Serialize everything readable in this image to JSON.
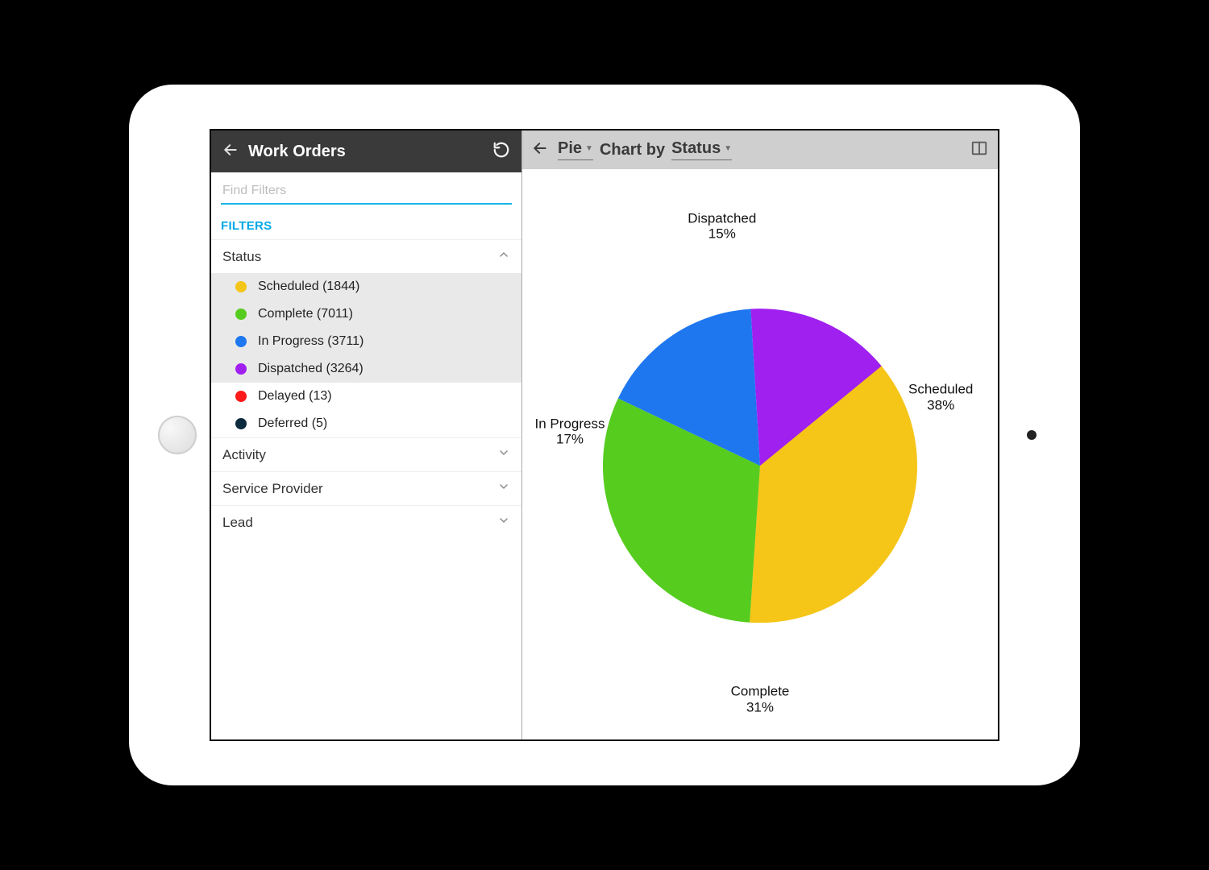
{
  "left": {
    "title": "Work Orders",
    "search_placeholder": "Find Filters",
    "filters_label": "FILTERS",
    "sections": {
      "status": {
        "label": "Status",
        "expanded": true
      },
      "activity": {
        "label": "Activity",
        "expanded": false
      },
      "service_provider": {
        "label": "Service Provider",
        "expanded": false
      },
      "lead": {
        "label": "Lead",
        "expanded": false
      }
    },
    "status_items": [
      {
        "label": "Scheduled (1844)",
        "color": "#f5c518",
        "selected": true
      },
      {
        "label": "Complete (7011)",
        "color": "#56cc1f",
        "selected": true
      },
      {
        "label": "In Progress (3711)",
        "color": "#1f77f0",
        "selected": true
      },
      {
        "label": "Dispatched (3264)",
        "color": "#a020f0",
        "selected": true
      },
      {
        "label": "Delayed (13)",
        "color": "#ff1a1a",
        "selected": false
      },
      {
        "label": "Deferred (5)",
        "color": "#0d2b3e",
        "selected": false
      }
    ]
  },
  "right": {
    "chart_type": "Pie",
    "mid_word": "Chart by",
    "group_by": "Status"
  },
  "chart_data": {
    "type": "pie",
    "title": "",
    "slices": [
      {
        "name": "Scheduled",
        "percent": 38,
        "color": "#f5c518"
      },
      {
        "name": "Complete",
        "percent": 31,
        "color": "#56cc1f"
      },
      {
        "name": "In Progress",
        "percent": 17,
        "color": "#1f77f0"
      },
      {
        "name": "Dispatched",
        "percent": 15,
        "color": "#a020f0"
      }
    ],
    "label_positions": [
      {
        "x_pct": 88,
        "y_pct": 40
      },
      {
        "x_pct": 50,
        "y_pct": 93
      },
      {
        "x_pct": 10,
        "y_pct": 46
      },
      {
        "x_pct": 42,
        "y_pct": 10
      }
    ],
    "start_angle_deg": -43,
    "radius_px": 195,
    "center": {
      "x_pct": 50,
      "y_pct": 52
    }
  }
}
